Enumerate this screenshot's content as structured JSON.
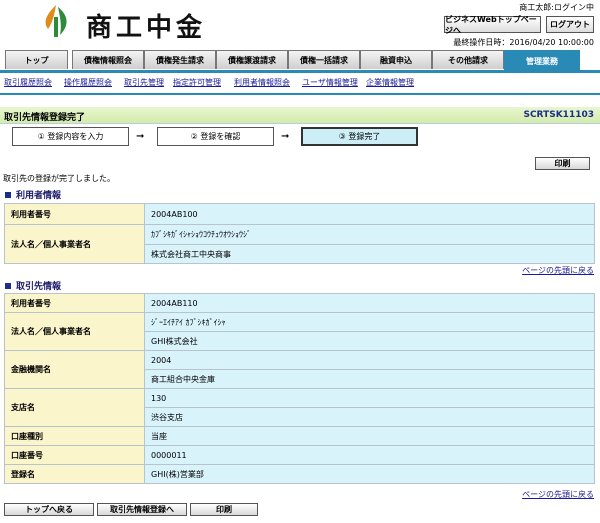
{
  "header": {
    "logo_text": "商工中金",
    "user_status": "商工太郎:ログイン中",
    "btn_web_top": "ビジネスWebトップページへ",
    "btn_logout": "ログアウト",
    "last_operation": "最終操作日時：2016/04/20 10:00:00"
  },
  "tabs": [
    "トップ",
    "債権情報照会",
    "債権発生請求",
    "債権譲渡請求",
    "債権一括請求",
    "融資申込",
    "その他請求",
    "管理業務"
  ],
  "subnav": [
    "取引履歴照会",
    "操作履歴照会",
    "取引先管理",
    "指定許可管理",
    "利用者情報照会",
    "ユーザ情報管理",
    "企業情報管理"
  ],
  "page": {
    "title": "取引先情報登録完了",
    "screen_id": "SCRTSK11103",
    "steps": [
      "① 登録内容を入力",
      "② 登録を確認",
      "③ 登録完了"
    ],
    "print_label": "印刷",
    "message": "取引先の登録が完了しました。"
  },
  "user_info": {
    "heading": "利用者情報",
    "user_number_label": "利用者番号",
    "user_number": "2004AB100",
    "name_label": "法人名／個人事業者名",
    "name_kana": "ｶﾌﾞｼｷｶﾞｲｼｬｼｮｳｺｳﾁｭｳｵｳｼｮｳｼﾞ",
    "name": "株式会社商工中央商事"
  },
  "partner_info": {
    "heading": "取引先情報",
    "user_number_label": "利用者番号",
    "user_number": "2004AB110",
    "name_label": "法人名／個人事業者名",
    "name_kana": "ｼﾞｰｴｲﾁｱｲ ｶﾌﾞｼｷｶﾞｲｼｬ",
    "name": "GHI株式会社",
    "bank_label": "金融機関名",
    "bank_code": "2004",
    "bank_name": "商工組合中央金庫",
    "branch_label": "支店名",
    "branch_code": "130",
    "branch_name": "渋谷支店",
    "account_type_label": "口座種別",
    "account_type": "当座",
    "account_number_label": "口座番号",
    "account_number": "0000011",
    "registered_name_label": "登録名",
    "registered_name": "GHI(株)営業部"
  },
  "page_top_link": "ページの先頭に戻る",
  "footer": {
    "btn_top": "トップへ戻る",
    "btn_partner_register": "取引先情報登録へ",
    "btn_print": "印刷"
  }
}
